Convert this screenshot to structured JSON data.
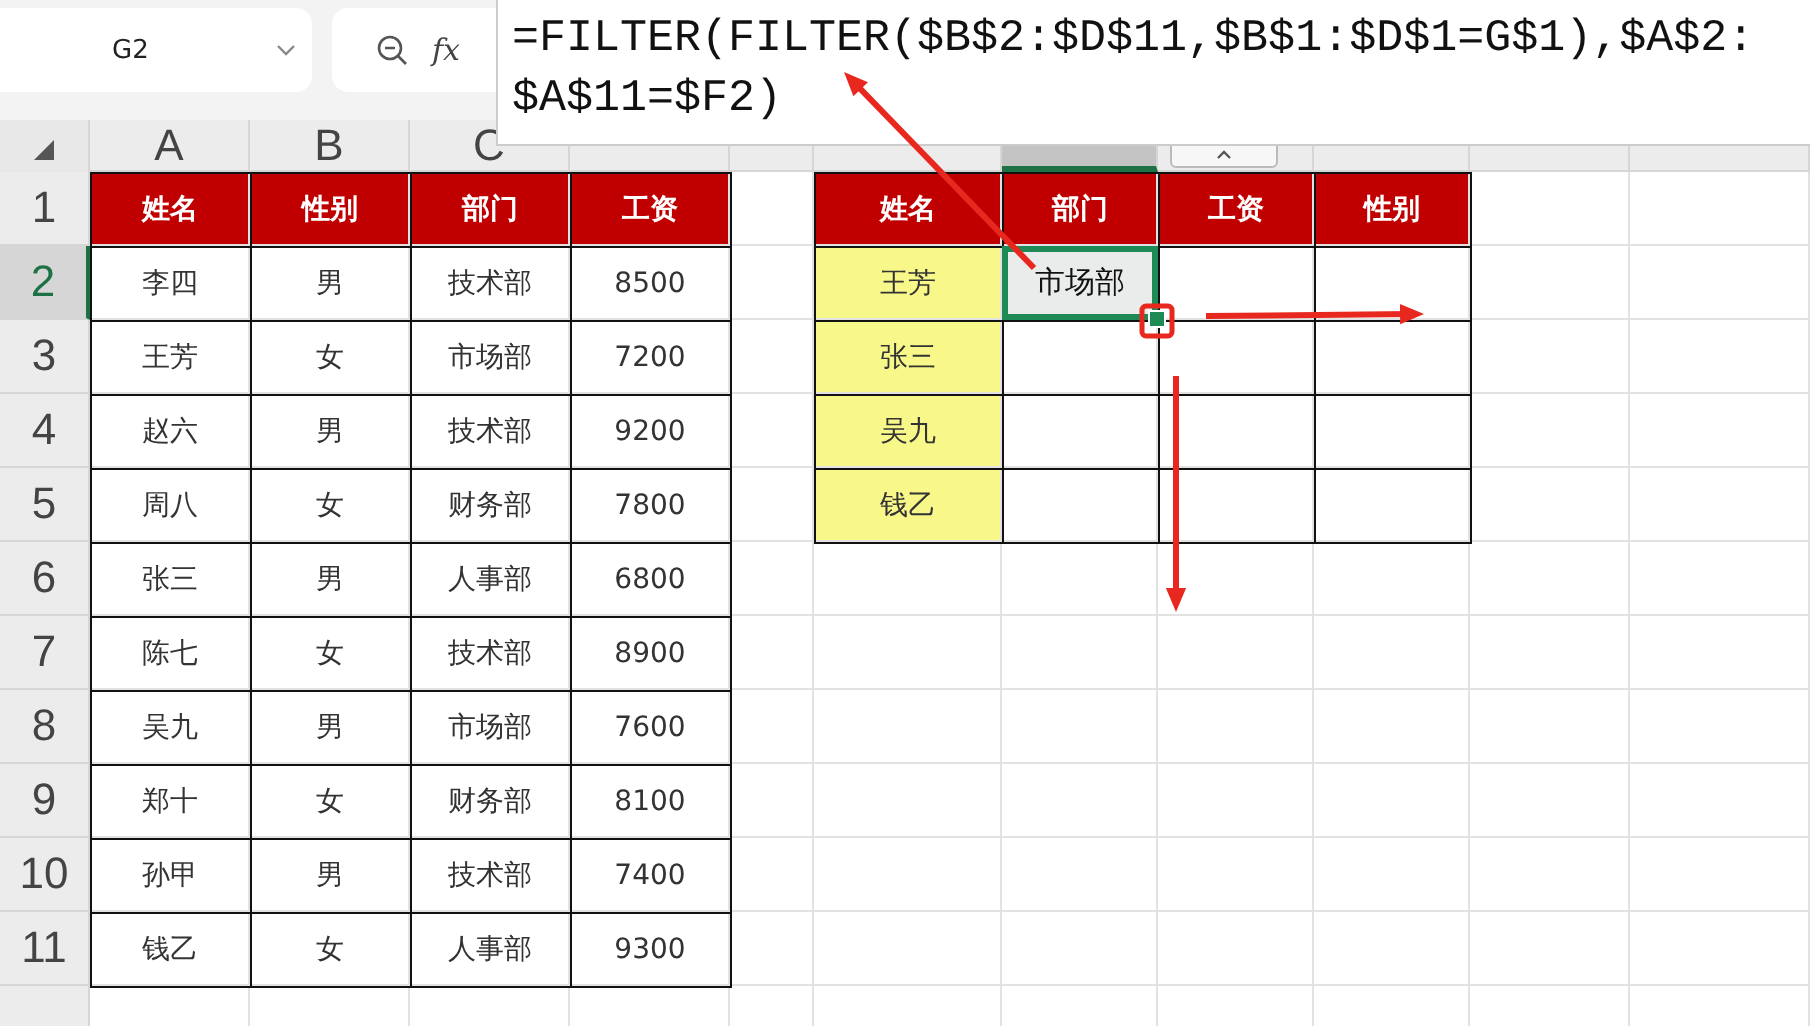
{
  "name_box": {
    "value": "G2"
  },
  "formula_bar": {
    "fx": "fx",
    "lines": [
      "=FILTER(FILTER($B$2:$D$11,$B$1:$D$1=G$1),$A$2:",
      "$A$11=$F2)"
    ]
  },
  "column_headers": [
    {
      "label": "A",
      "selected": false
    },
    {
      "label": "B",
      "selected": false
    },
    {
      "label": "C",
      "selected": false
    },
    {
      "selected": false
    },
    {
      "selected": false
    },
    {
      "selected": false
    },
    {
      "selected": true
    },
    {
      "selected": false
    },
    {
      "selected": false
    },
    {
      "selected": false
    },
    {
      "selected": false
    }
  ],
  "row_headers": [
    {
      "label": "1",
      "selected": false
    },
    {
      "label": "2",
      "selected": true
    },
    {
      "label": "3",
      "selected": false
    },
    {
      "label": "4",
      "selected": false
    },
    {
      "label": "5",
      "selected": false
    },
    {
      "label": "6",
      "selected": false
    },
    {
      "label": "7",
      "selected": false
    },
    {
      "label": "8",
      "selected": false
    },
    {
      "label": "9",
      "selected": false
    },
    {
      "label": "10",
      "selected": false
    },
    {
      "label": "11",
      "selected": false
    },
    {
      "selected": false
    }
  ],
  "source_table": {
    "header": [
      "姓名",
      "性别",
      "部门",
      "工资"
    ],
    "rows": [
      [
        "李四",
        "男",
        "技术部",
        "8500"
      ],
      [
        "王芳",
        "女",
        "市场部",
        "7200"
      ],
      [
        "赵六",
        "男",
        "技术部",
        "9200"
      ],
      [
        "周八",
        "女",
        "财务部",
        "7800"
      ],
      [
        "张三",
        "男",
        "人事部",
        "6800"
      ],
      [
        "陈七",
        "女",
        "技术部",
        "8900"
      ],
      [
        "吴九",
        "男",
        "市场部",
        "7600"
      ],
      [
        "郑十",
        "女",
        "财务部",
        "8100"
      ],
      [
        "孙甲",
        "男",
        "技术部",
        "7400"
      ],
      [
        "钱乙",
        "女",
        "人事部",
        "9300"
      ]
    ]
  },
  "result_table": {
    "header": [
      "姓名",
      "部门",
      "工资",
      "性别"
    ],
    "rows": [
      {
        "name": "王芳",
        "department": {
          "text": "市场部",
          "selected": true
        }
      },
      {
        "name": "张三"
      },
      {
        "name": "吴九"
      },
      {
        "name": "钱乙"
      }
    ]
  }
}
